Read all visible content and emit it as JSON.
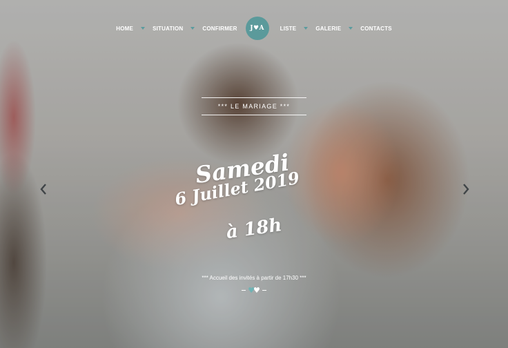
{
  "nav": {
    "items_left": [
      "HOME",
      "SITUATION",
      "CONFIRMER"
    ],
    "logo": "J♥A",
    "items_right": [
      "LISTE",
      "GALERIE",
      "CONTACTS"
    ],
    "accent": "#5b9a9b"
  },
  "hero": {
    "label": "*** LE MARIAGE ***",
    "day": "Samedi",
    "date": "6 Juillet 2019",
    "hour": "à 18h",
    "welcome": "*** Accueil des invités à partir de 17h30 ***",
    "heart_icon": "♥"
  },
  "carousel": {
    "prev_icon": "chevron-left-icon",
    "next_icon": "chevron-right-icon"
  }
}
